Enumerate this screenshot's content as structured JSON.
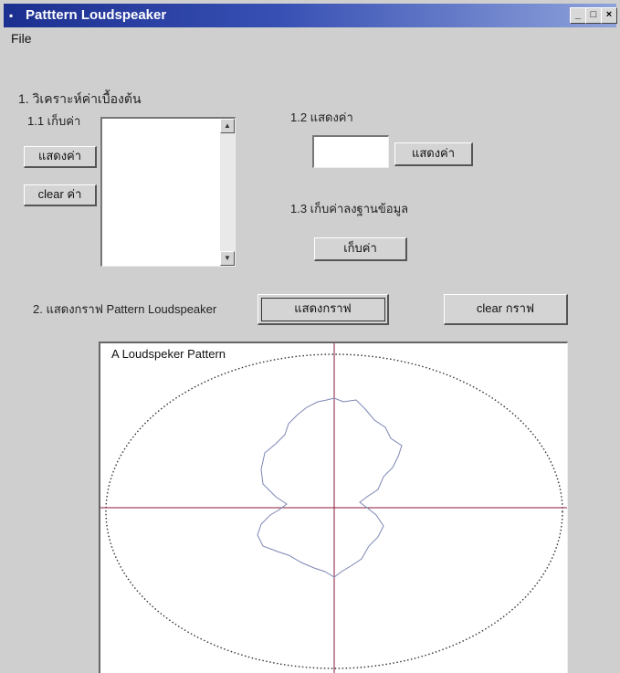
{
  "window": {
    "title": "Patttern Loudspeaker",
    "min": "_",
    "max": "□",
    "close": "×"
  },
  "menu": {
    "file": "File"
  },
  "section1": {
    "heading": "1. วิเคราะห์ค่าเบื้องต้น",
    "s11_label": "1.1 เก็บค่า",
    "show_button": "แสดงค่า",
    "clear_button": "clear ค่า",
    "s12_label": "1.2 แสดงค่า",
    "show_button2": "แสดงค่า",
    "s13_label": "1.3 เก็บค่าลงฐานข้อมูล",
    "store_button": "เก็บค่า"
  },
  "section2": {
    "label": "2. แสดงกราฟ Pattern Loudspeaker",
    "show_graph_button": "แสดงกราฟ",
    "clear_graph_button": "clear กราฟ"
  },
  "plot": {
    "title": "A Loudspeker Pattern",
    "axis_color": "#8b1a3a",
    "pattern_color": "#7d86b4",
    "ellipse_color": "#333333"
  }
}
